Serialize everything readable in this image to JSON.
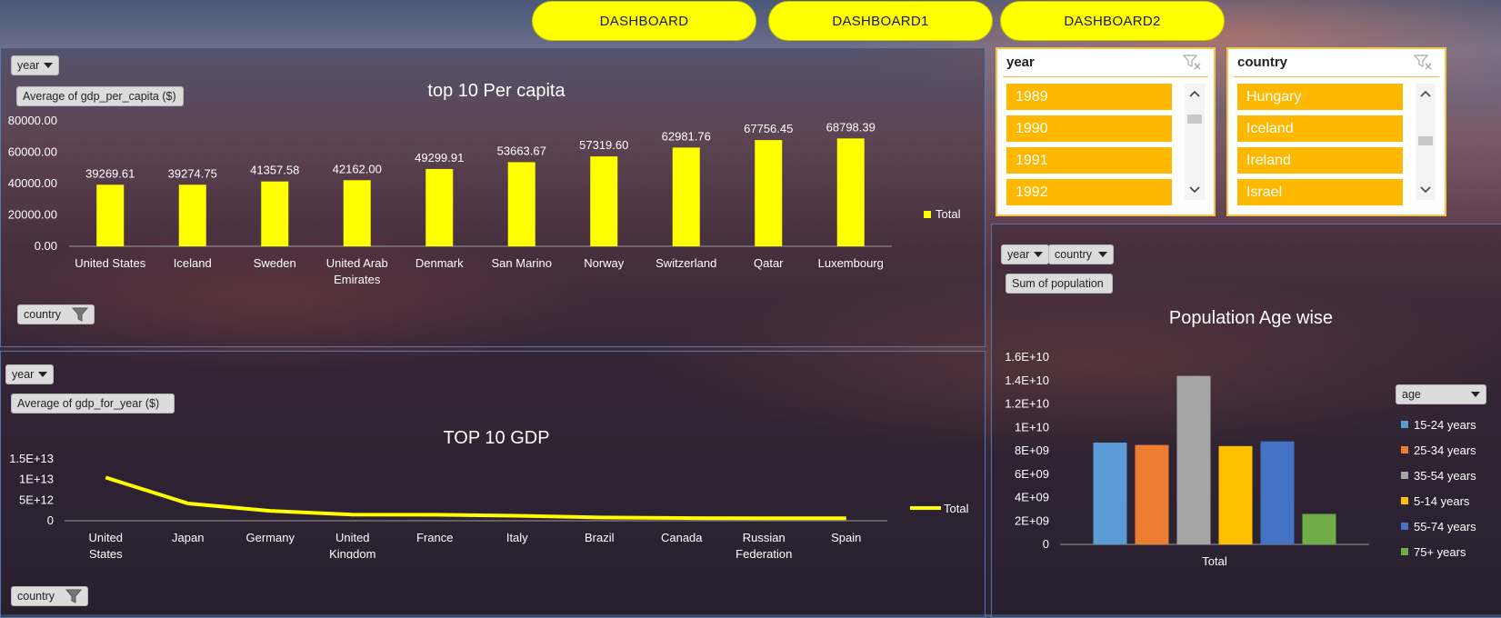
{
  "nav": [
    "DASHBOARD",
    "DASHBOARD1",
    "DASHBOARD2"
  ],
  "gdp_capita": {
    "year_filter": "year",
    "value_field": "Average of gdp_per_capita ($)",
    "country_filter": "country",
    "title": "top 10 Per capita",
    "legend": "Total",
    "bar_color": "#ffff00"
  },
  "gdp_total": {
    "year_filter": "year",
    "value_field": "Average of  gdp_for_year ($)",
    "country_filter": "country",
    "title": "TOP 10 GDP",
    "legend": "Total",
    "line_color": "#ffff00"
  },
  "population": {
    "year_filter": "year",
    "country_filter": "country",
    "value_field": "Sum of population",
    "title": "Population Age wise",
    "legend_title": "age"
  },
  "slicers": {
    "year": {
      "title": "year",
      "items": [
        "1989",
        "1990",
        "1991",
        "1992"
      ]
    },
    "country": {
      "title": "country",
      "items": [
        "Hungary",
        "Iceland",
        "Ireland",
        "Israel"
      ]
    }
  },
  "chart_data": [
    {
      "type": "bar",
      "title": "top 10 Per capita",
      "categories": [
        "United States",
        "Iceland",
        "Sweden",
        "United Arab Emirates",
        "Denmark",
        "San Marino",
        "Norway",
        "Switzerland",
        "Qatar",
        "Luxembourg"
      ],
      "series": [
        {
          "name": "Total",
          "values": [
            39269.61,
            39274.75,
            41357.58,
            42162.0,
            49299.91,
            53663.67,
            57319.6,
            62981.76,
            67756.45,
            68798.39
          ]
        }
      ],
      "data_labels": [
        "39269.61",
        "39274.75",
        "41357.58",
        "42162.00",
        "49299.91",
        "53663.67",
        "57319.60",
        "62981.76",
        "67756.45",
        "68798.39"
      ],
      "yticks": [
        "0.00",
        "20000.00",
        "40000.00",
        "60000.00",
        "80000.00"
      ],
      "ylim": [
        0,
        80000
      ],
      "legend": "right"
    },
    {
      "type": "line",
      "title": "TOP 10 GDP",
      "categories": [
        "United States",
        "Japan",
        "Germany",
        "United Kingdom",
        "France",
        "Italy",
        "Brazil",
        "Canada",
        "Russian Federation",
        "Spain"
      ],
      "series": [
        {
          "name": "Total",
          "values": [
            10500000000000.0,
            4200000000000.0,
            2400000000000.0,
            1500000000000.0,
            1450000000000.0,
            1200000000000.0,
            800000000000.0,
            650000000000.0,
            600000000000.0,
            600000000000.0
          ]
        }
      ],
      "yticks": [
        "0",
        "5E+12",
        "1E+13",
        "1.5E+13"
      ],
      "ylim": [
        0,
        15000000000000.0
      ],
      "legend": "right"
    },
    {
      "type": "bar",
      "title": "Population Age wise",
      "categories": [
        "Total"
      ],
      "series": [
        {
          "name": "15-24 years",
          "values": [
            8700000000.0
          ],
          "color": "#5b9bd5"
        },
        {
          "name": "25-34 years",
          "values": [
            8500000000.0
          ],
          "color": "#ed7d31"
        },
        {
          "name": "35-54 years",
          "values": [
            14400000000.0
          ],
          "color": "#a5a5a5"
        },
        {
          "name": "5-14 years",
          "values": [
            8400000000.0
          ],
          "color": "#ffc000"
        },
        {
          "name": "55-74 years",
          "values": [
            8800000000.0
          ],
          "color": "#4472c4"
        },
        {
          "name": "75+ years",
          "values": [
            2600000000.0
          ],
          "color": "#70ad47"
        }
      ],
      "yticks": [
        "0",
        "2E+09",
        "4E+09",
        "6E+09",
        "8E+09",
        "1E+10",
        "1.2E+10",
        "1.4E+10",
        "1.6E+10"
      ],
      "ylim": [
        0,
        16000000000.0
      ],
      "legend": "right"
    }
  ]
}
